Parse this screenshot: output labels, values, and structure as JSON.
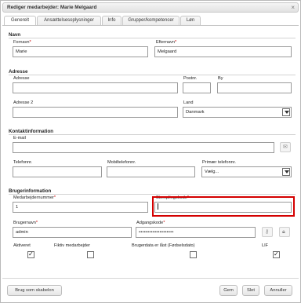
{
  "window": {
    "title": "Rediger medarbejder: Marie Melgaard",
    "close_glyph": "×"
  },
  "tabs": [
    {
      "label": "Generelt"
    },
    {
      "label": "Ansættelsesoplysninger"
    },
    {
      "label": "Info"
    },
    {
      "label": "Grupper/kompetencer"
    },
    {
      "label": "Løn"
    }
  ],
  "navn": {
    "heading": "Navn",
    "fornavn_label": "Fornavn",
    "fornavn_value": "Marie",
    "efternavn_label": "Efternavn",
    "efternavn_value": "Melgaard",
    "required_mark": "*"
  },
  "adresse": {
    "heading": "Adresse",
    "adresse_label": "Adresse",
    "adresse_value": "",
    "postnr_label": "Postnr.",
    "postnr_value": "",
    "by_label": "By",
    "by_value": "",
    "adresse2_label": "Adresse 2",
    "adresse2_value": "",
    "land_label": "Land",
    "land_value": "Danmark"
  },
  "kontakt": {
    "heading": "Kontaktinformation",
    "email_label": "E-mail",
    "email_value": "",
    "email_icon": "mail-icon",
    "telefon_label": "Telefonnr.",
    "telefon_value": "",
    "mobil_label": "Mobiltelefonnr.",
    "mobil_value": "",
    "primaer_label": "Primær telefonnr.",
    "primaer_value": "Vælg..."
  },
  "bruger": {
    "heading": "Brugerinformation",
    "medarbejdernr_label": "Medarbejdernummer",
    "medarbejdernr_value": "1",
    "stempling_label": "Stemplingskode",
    "stempling_value": "",
    "brugernavn_label": "Brugernavn",
    "brugernavn_value": "admin",
    "adgangskode_label": "Adgangskode",
    "adgangskode_value": "••••••••••••••••••••",
    "key_icon": "key-icon",
    "lock_icon": "lock-icon",
    "aktiveret_label": "Aktiveret",
    "aktiveret_checked": true,
    "fiktiv_label": "Fiktiv medarbejder",
    "fiktiv_checked": false,
    "brugerdata_label": "Brugerdata er låst (Fødselsdato)",
    "brugerdata_checked": false,
    "lif_label": "LIF",
    "lif_checked": true
  },
  "footer": {
    "skabelon_label": "Brug som skabelon",
    "gem_label": "Gem",
    "slet_label": "Slet",
    "annuller_label": "Annuller"
  },
  "colors": {
    "highlight": "#d40000",
    "required": "#cc0000"
  }
}
